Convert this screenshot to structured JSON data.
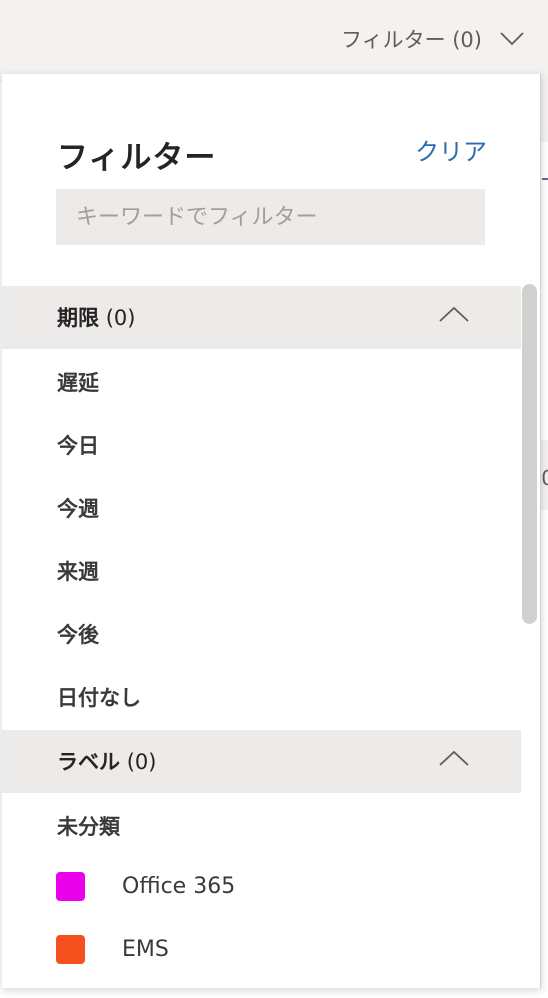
{
  "topbar": {
    "filter_label": "フィルター (0)",
    "chevron_icon": "chevron-down-icon"
  },
  "background": {
    "partial_text": "0"
  },
  "panel": {
    "title": "フィルター",
    "clear_label": "クリア",
    "keyword_placeholder": "キーワードでフィルター",
    "sections": {
      "due": {
        "title": "期限",
        "count": "(0)",
        "chevron_icon": "chevron-up-icon",
        "options": [
          "遅延",
          "今日",
          "今週",
          "来週",
          "今後",
          "日付なし"
        ]
      },
      "labels": {
        "title": "ラベル",
        "count": "(0)",
        "chevron_icon": "chevron-up-icon",
        "uncategorized": "未分類",
        "items": [
          {
            "name": "Office 365",
            "color": "#ea00ea"
          },
          {
            "name": "EMS",
            "color": "#f4511e"
          }
        ]
      }
    }
  },
  "colors": {
    "accent": "#2b6cb0",
    "section_bg": "#edebe9",
    "topbar_bg": "#f3f2f1"
  }
}
